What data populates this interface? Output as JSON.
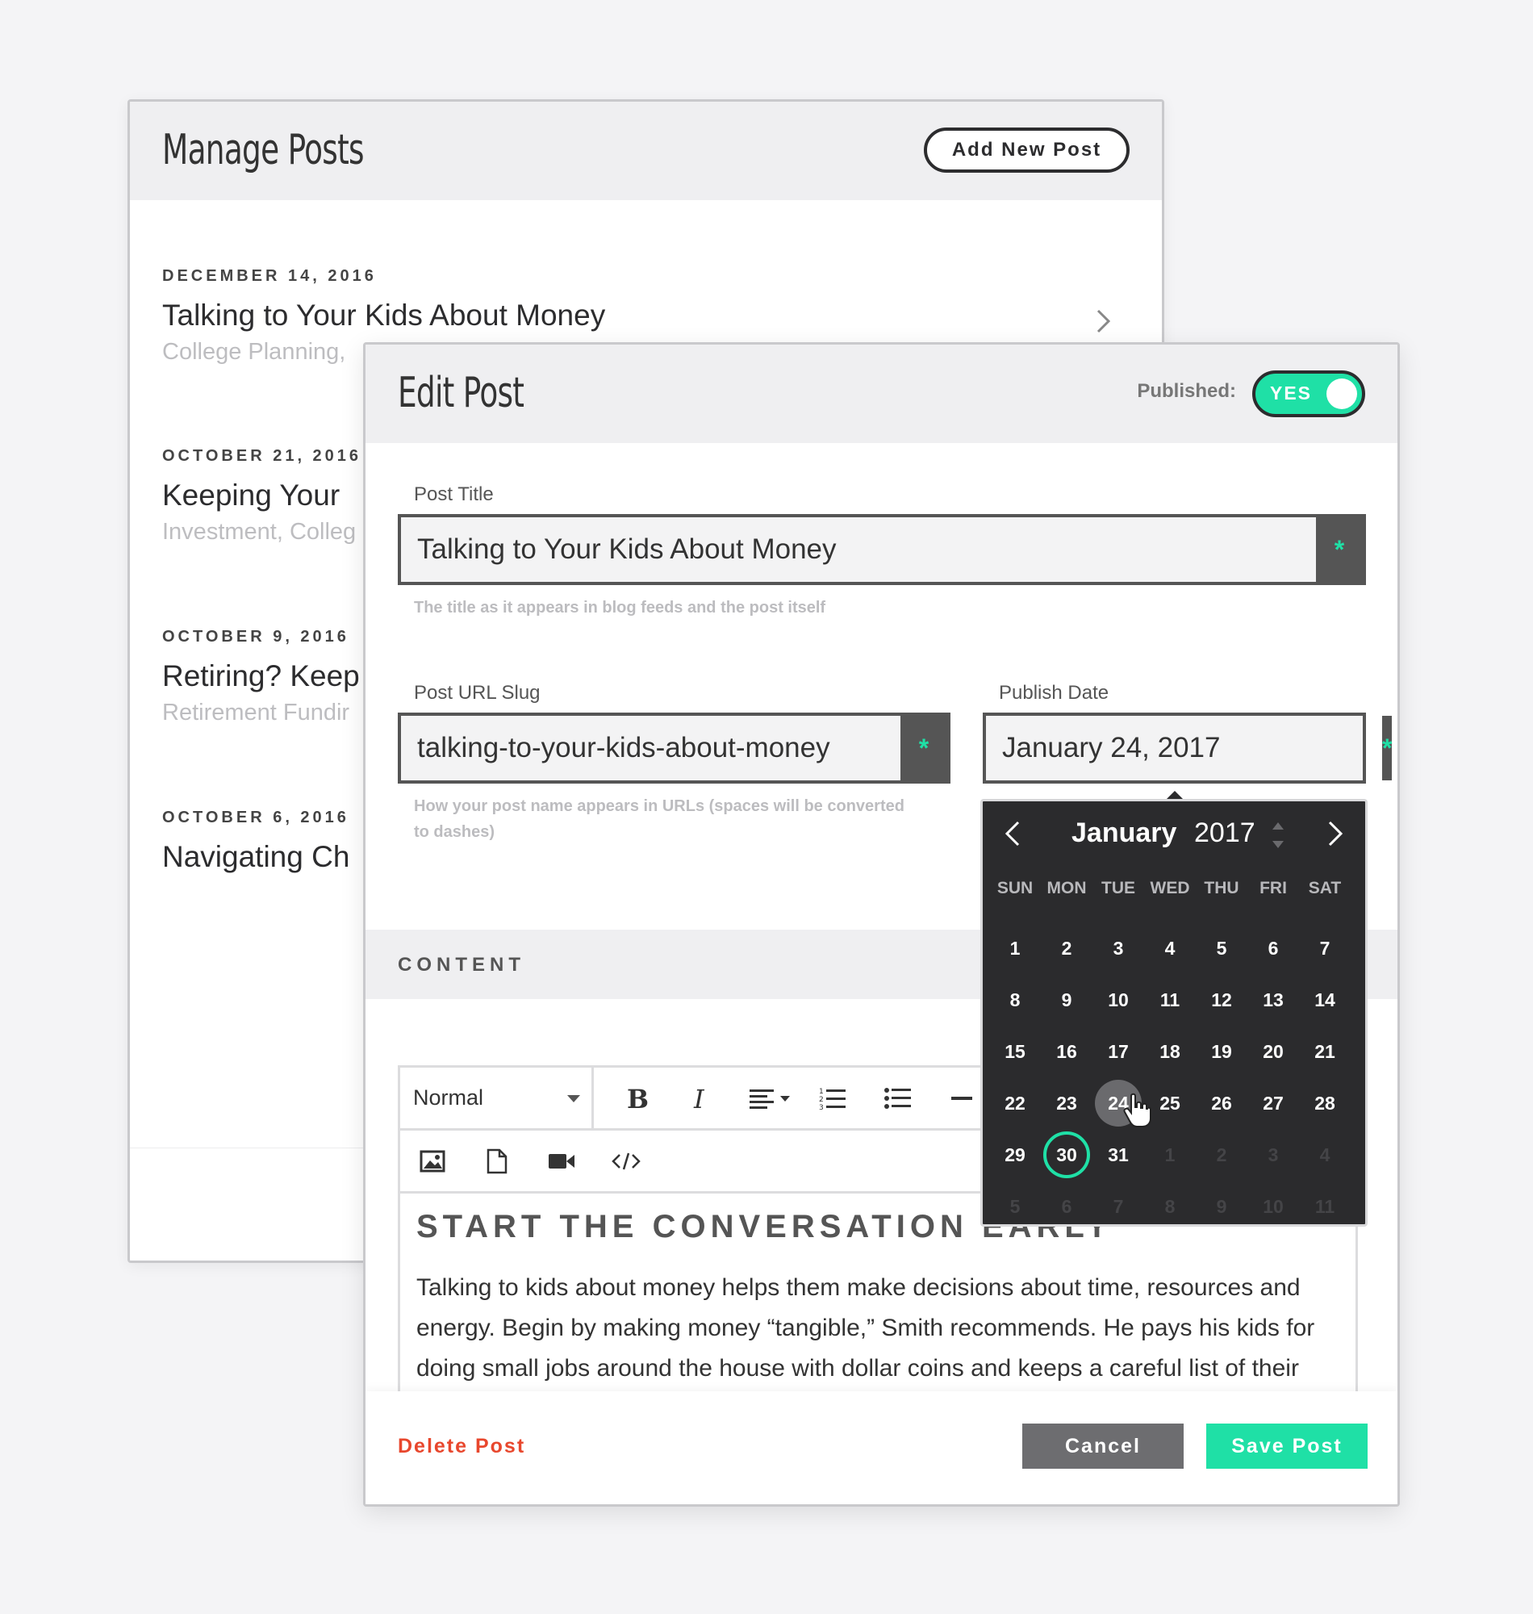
{
  "manage": {
    "title": "Manage Posts",
    "add_button": "Add New Post",
    "posts": [
      {
        "date": "DECEMBER 14, 2016",
        "title": "Talking to Your Kids About Money",
        "categories": "College Planning,"
      },
      {
        "date": "OCTOBER 21, 2016",
        "title": "Keeping Your",
        "categories": "Investment, Colleg"
      },
      {
        "date": "OCTOBER 9, 2016",
        "title": "Retiring? Keep",
        "categories": "Retirement Fundir"
      },
      {
        "date": "OCTOBER 6, 2016",
        "title": "Navigating Ch",
        "categories": ""
      }
    ]
  },
  "edit": {
    "title": "Edit Post",
    "published_label": "Published:",
    "published_toggle": "YES",
    "post_title": {
      "label": "Post Title",
      "value": "Talking to Your Kids About Money",
      "required": "*",
      "help": "The title as it appears in blog feeds and the post itself"
    },
    "slug": {
      "label": "Post URL Slug",
      "value": "talking-to-your-kids-about-money",
      "required": "*",
      "help_line1": "How your post name appears in URLs (spaces will be converted",
      "help_line2": "to dashes)"
    },
    "publish_date": {
      "label": "Publish Date",
      "value": "January 24, 2017",
      "required": "*"
    },
    "content_label": "CONTENT",
    "editor": {
      "format": "Normal",
      "heading": "START THE CONVERSATION EARLY",
      "body": "Talking to kids about money helps them make decisions about time, resources and energy. Begin by making money “tangible,” Smith recommends. He pays his kids for doing small jobs around the house with dollar coins and keeps a careful list of their"
    },
    "footer": {
      "delete": "Delete Post",
      "cancel": "Cancel",
      "save": "Save Post"
    }
  },
  "datepicker": {
    "month": "January",
    "year": "2017",
    "weekdays": [
      "SUN",
      "MON",
      "TUE",
      "WED",
      "THU",
      "FRI",
      "SAT"
    ],
    "days": [
      [
        "1",
        "2",
        "3",
        "4",
        "5",
        "6",
        "7"
      ],
      [
        "8",
        "9",
        "10",
        "11",
        "12",
        "13",
        "14"
      ],
      [
        "15",
        "16",
        "17",
        "18",
        "19",
        "20",
        "21"
      ],
      [
        "22",
        "23",
        "24",
        "25",
        "26",
        "27",
        "28"
      ],
      [
        "29",
        "30",
        "31",
        "1",
        "2",
        "3",
        "4"
      ],
      [
        "5",
        "6",
        "7",
        "8",
        "9",
        "10",
        "11"
      ]
    ],
    "hover_day": "24",
    "selected_day": "30"
  },
  "colors": {
    "accent": "#1fe0a6",
    "danger": "#e8472d",
    "dark": "#2b2b2d",
    "field_border": "#555555"
  }
}
